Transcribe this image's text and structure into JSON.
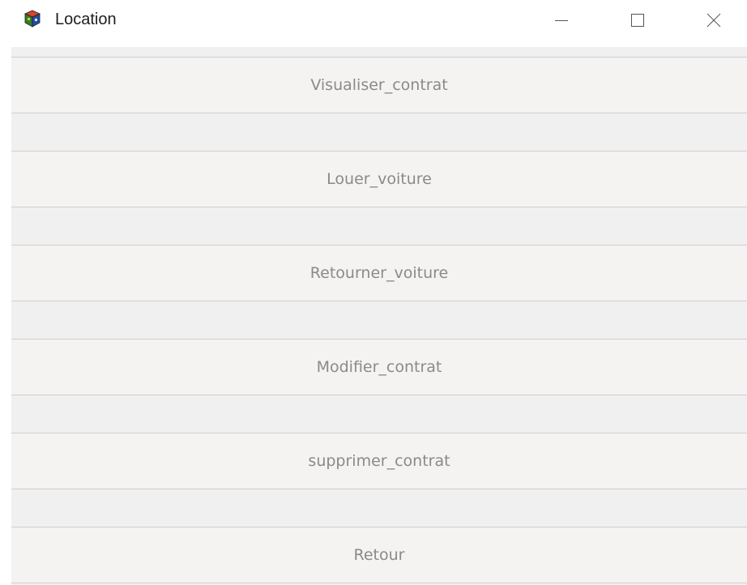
{
  "window": {
    "title": "Location",
    "icon": "app-cube-icon",
    "controls": {
      "minimize": "minimize-icon",
      "maximize": "maximize-icon",
      "close": "close-icon"
    }
  },
  "buttons": [
    {
      "label": "Visualiser_contrat"
    },
    {
      "label": "Louer_voiture"
    },
    {
      "label": "Retourner_voiture"
    },
    {
      "label": "Modifier_contrat"
    },
    {
      "label": "supprimer_contrat"
    },
    {
      "label": "Retour"
    }
  ],
  "colors": {
    "button_bg": "#f4f3f2",
    "button_text": "#8a8a8a",
    "panel_bg": "#f0f0f0",
    "border": "#cfcfcf"
  }
}
